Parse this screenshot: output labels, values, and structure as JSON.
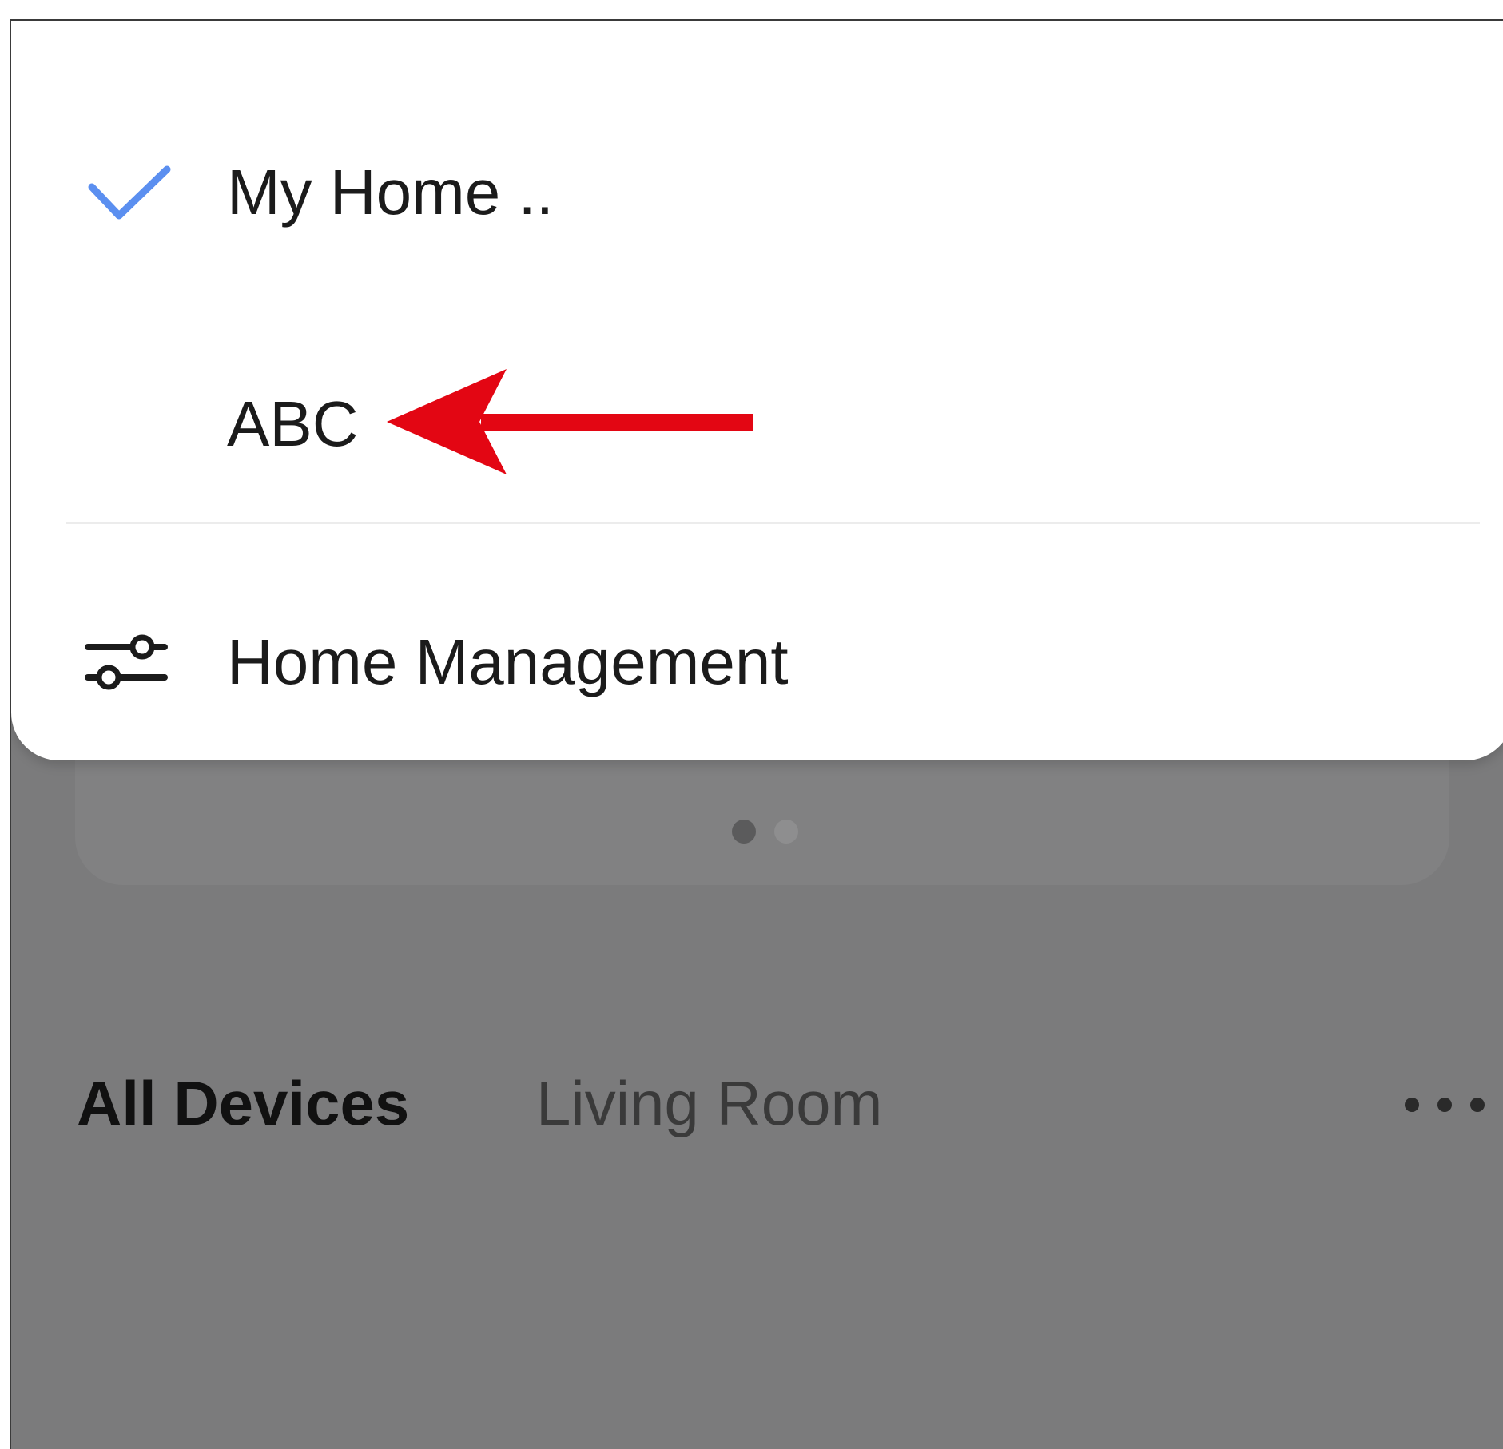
{
  "home_switcher": {
    "homes": [
      {
        "label": "My Home ..",
        "selected": true,
        "icon": "check-icon"
      },
      {
        "label": "ABC",
        "selected": false
      }
    ],
    "management": {
      "label": "Home Management",
      "icon": "sliders-icon"
    }
  },
  "background": {
    "carousel": {
      "pages": 2,
      "active_page": 1
    },
    "room_tabs": [
      {
        "label": "All Devices",
        "active": true
      },
      {
        "label": "Living Room",
        "active": false
      }
    ],
    "more_icon": "more-horizontal-icon"
  },
  "annotation": {
    "type": "arrow",
    "color": "#e30613",
    "points_to": "ABC"
  },
  "colors": {
    "check": "#5b8ff0",
    "overlay": "#7b7b7c",
    "arrow": "#e30613"
  }
}
